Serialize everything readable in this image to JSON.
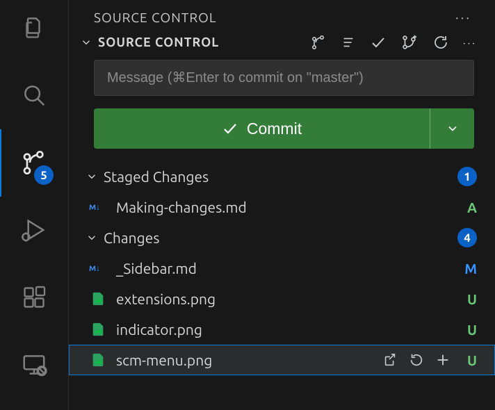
{
  "activityBar": {
    "badge": "5"
  },
  "panel": {
    "title": "SOURCE CONTROL",
    "sectionTitle": "SOURCE CONTROL"
  },
  "commit": {
    "placeholder": "Message (⌘Enter to commit on \"master\")",
    "buttonLabel": "Commit"
  },
  "groups": {
    "staged": {
      "label": "Staged Changes",
      "count": "1"
    },
    "changes": {
      "label": "Changes",
      "count": "4"
    }
  },
  "files": {
    "staged": [
      {
        "name": "Making-changes.md",
        "status": "A",
        "kind": "md"
      }
    ],
    "changes": [
      {
        "name": "_Sidebar.md",
        "status": "M",
        "kind": "md"
      },
      {
        "name": "extensions.png",
        "status": "U",
        "kind": "img"
      },
      {
        "name": "indicator.png",
        "status": "U",
        "kind": "img"
      },
      {
        "name": "scm-menu.png",
        "status": "U",
        "kind": "img"
      }
    ]
  }
}
